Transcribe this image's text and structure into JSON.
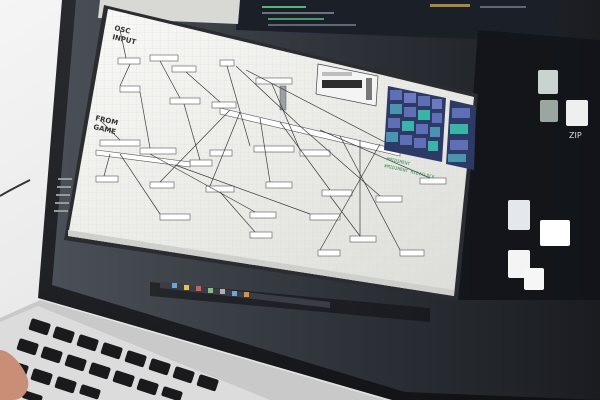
{
  "photo": {
    "subject": "laptop-screen-showing-patching-software"
  },
  "patcher_window": {
    "comments": {
      "osc_input_line1": "OSC",
      "osc_input_line2": "INPUT",
      "from_game_line1": "FROM",
      "from_game_line2": "GAME"
    },
    "status_lines": [
      "#MIDIMENT",
      "#MIDIMENT MIDICLOCK"
    ]
  },
  "colors": {
    "grid_cell": "#5f6fb6",
    "grid_cell_alt": "#4b93b0",
    "grid_accent": "#3ab3a8",
    "editor_bg": "#1b1f27",
    "code_green": "#5bd08e",
    "patch_bg": "#f2f2f0"
  },
  "desktop_icons": [
    {
      "label": "ZIP"
    }
  ]
}
